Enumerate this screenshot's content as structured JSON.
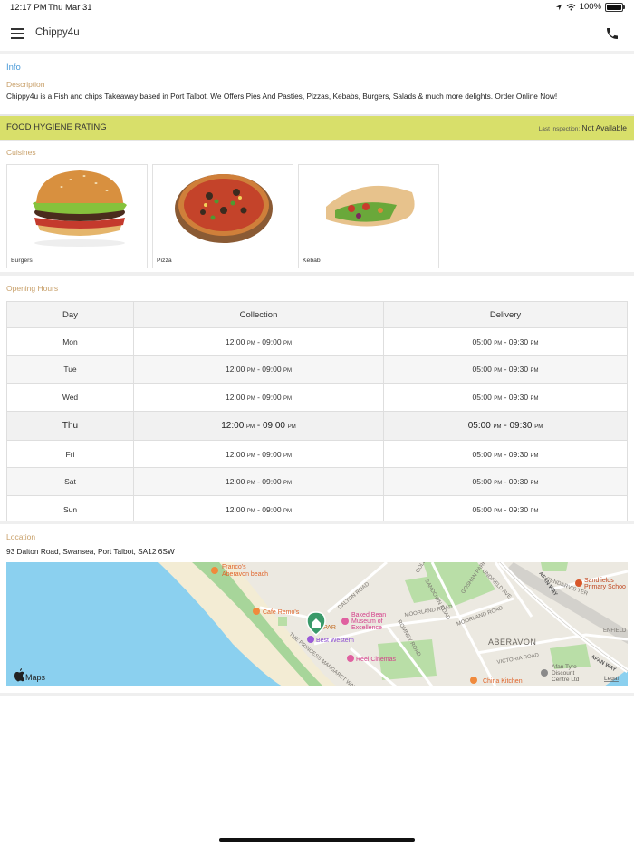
{
  "status_bar": {
    "time": "12:17 PM",
    "date": "Thu Mar 31",
    "battery": "100%",
    "battery_level": 1.0
  },
  "nav": {
    "title": "Chippy4u",
    "menu_icon": "hamburger-icon",
    "phone_icon": "phone-icon"
  },
  "info": {
    "section_label": "Info",
    "description_label": "Description",
    "description": "Chippy4u is a Fish and chips Takeaway based in Port Talbot. We Offers Pies And Pasties, Pizzas, Kebabs, Burgers, Salads & much more delights. Order Online Now!"
  },
  "hygiene": {
    "title": "FOOD HYGIENE RATING",
    "last_inspection_label": "Last Inspection:",
    "last_inspection_value": "Not Available",
    "color": "#d8df6a"
  },
  "cuisines": {
    "label": "Cuisines",
    "items": [
      {
        "name": "Burgers"
      },
      {
        "name": "Pizza"
      },
      {
        "name": "Kebab"
      }
    ]
  },
  "opening_hours": {
    "label": "Opening Hours",
    "headers": [
      "Day",
      "Collection",
      "Delivery"
    ],
    "rows": [
      {
        "day": "Mon",
        "col_open": "12:00",
        "col_close": "09:00",
        "del_open": "05:00",
        "del_close": "09:30"
      },
      {
        "day": "Tue",
        "col_open": "12:00",
        "col_close": "09:00",
        "del_open": "05:00",
        "del_close": "09:30"
      },
      {
        "day": "Wed",
        "col_open": "12:00",
        "col_close": "09:00",
        "del_open": "05:00",
        "del_close": "09:30"
      },
      {
        "day": "Thu",
        "col_open": "12:00",
        "col_close": "09:00",
        "del_open": "05:00",
        "del_close": "09:30",
        "today": true
      },
      {
        "day": "Fri",
        "col_open": "12:00",
        "col_close": "09:00",
        "del_open": "05:00",
        "del_close": "09:30"
      },
      {
        "day": "Sat",
        "col_open": "12:00",
        "col_close": "09:00",
        "del_open": "05:00",
        "del_close": "09:30"
      },
      {
        "day": "Sun",
        "col_open": "12:00",
        "col_close": "09:00",
        "del_open": "05:00",
        "del_close": "09:30"
      }
    ],
    "pm": "PM",
    "separator": "-"
  },
  "location": {
    "label": "Location",
    "address": "93 Dalton Road, Swansea, Port Talbot, SA12 6SW",
    "map_labels": {
      "francos": "Franco's",
      "francos2": "Aberavon beach",
      "cafe": "Cafe Remo's",
      "par": "PAR",
      "baked1": "Baked Bean",
      "baked2": "Museum of",
      "baked3": "Excellence",
      "bestwestern": "Best Western",
      "reel": "Reel Cinemas",
      "aberavon": "ABERAVON",
      "china": "China Kitchen",
      "afan1": "Afan Tyre",
      "afan2": "Discount",
      "afan3": "Centre Ltd",
      "sandfields1": "Sandfields",
      "sandfields2": "Primary Schoo",
      "afanway": "AFAN WAY",
      "afanway2": "AFAN WAY",
      "maps": "Maps",
      "legal": "Legal",
      "dalton": "DALTON ROAD",
      "moorland": "MOORLAND ROAD",
      "moorland2": "MOORLAND ROAD",
      "victoria": "VICTORIA ROAD",
      "princess": "THE PRINCESS MARGARET WAY",
      "sandown": "SANDOWN ROAD",
      "romney": "ROMNEY ROAD",
      "pendarvis": "PENDARVIS TER",
      "enfield": "ENFIELD",
      "unknown_road": "UNDFIELD AVE",
      "cold": "COLE",
      "cavan": "GOSHAN PARK"
    }
  }
}
